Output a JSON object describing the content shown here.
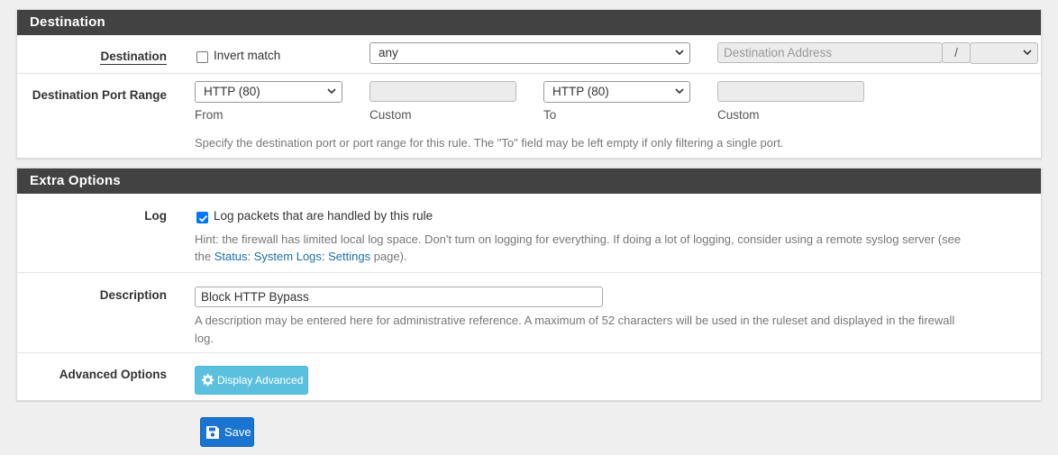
{
  "destination": {
    "heading": "Destination",
    "label": "Destination",
    "invert_match_label": "Invert match",
    "type_select": "any",
    "address_placeholder": "Destination Address",
    "mask_separator": "/",
    "mask_select": ""
  },
  "port_range": {
    "label": "Destination Port Range",
    "from_select": "HTTP (80)",
    "from_custom": "",
    "to_select": "HTTP (80)",
    "to_custom": "",
    "from_label": "From",
    "custom_label_1": "Custom",
    "to_label": "To",
    "custom_label_2": "Custom",
    "help": "Specify the destination port or port range for this rule. The \"To\" field may be left empty if only filtering a single port."
  },
  "extra": {
    "heading": "Extra Options",
    "log_label": "Log",
    "log_checkbox_label": "Log packets that are handled by this rule",
    "log_checked": true,
    "log_hint_1": "Hint: the firewall has limited local log space. Don't turn on logging for everything. If doing a lot of logging, consider using a remote syslog server (see",
    "log_hint_2_pre": "the ",
    "log_hint_link": "Status: System Logs: Settings",
    "log_hint_2_post": " page).",
    "description_label": "Description",
    "description_value": "Block HTTP Bypass",
    "description_help_1": "A description may be entered here for administrative reference. A maximum of 52 characters will be used in the ruleset and displayed in the firewall",
    "description_help_2": "log.",
    "advanced_label": "Advanced Options",
    "advanced_button": "Display Advanced"
  },
  "save_button": "Save",
  "colors": {
    "heading_bg": "#424242",
    "info_button": "#5bc0de",
    "primary_button": "#1a74d1",
    "link": "#1e6fa8"
  },
  "icons": [
    "chevron-down-icon",
    "check-icon",
    "gear-icon",
    "save-disk-icon"
  ]
}
